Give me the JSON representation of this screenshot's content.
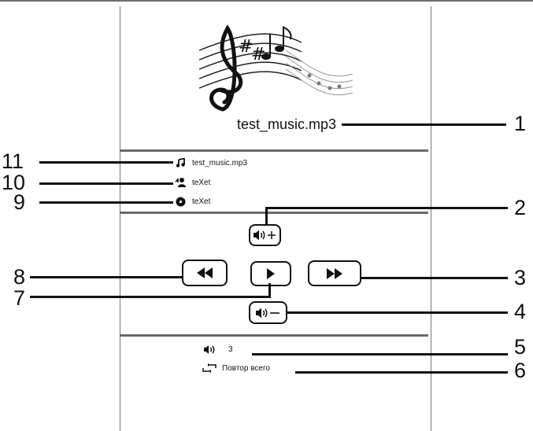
{
  "track": {
    "title": "test_music.mp3",
    "song_name": "test_music.mp3",
    "artist": "teXet",
    "album": "teXet"
  },
  "status": {
    "volume_value": "3",
    "repeat_mode": "Повтор всего"
  },
  "icons": {
    "song": "music-note-icon",
    "artist": "artist-icon",
    "album": "disc-icon",
    "volume": "speaker-icon",
    "repeat": "repeat-icon"
  },
  "callouts": [
    "1",
    "2",
    "3",
    "4",
    "5",
    "6",
    "7",
    "8",
    "9",
    "10",
    "11"
  ]
}
